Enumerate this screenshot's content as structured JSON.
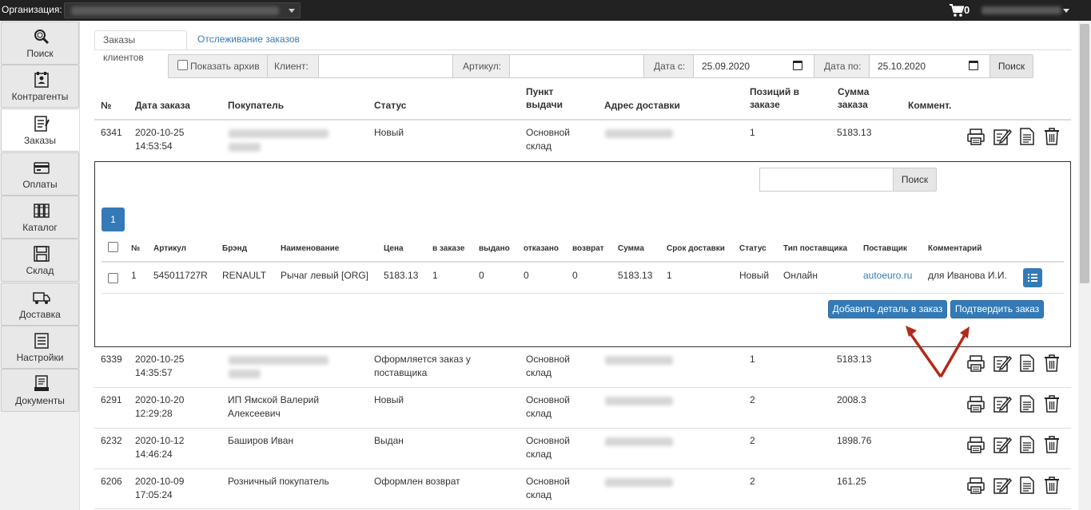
{
  "topbar": {
    "org_label": "Организация:",
    "cart_count": "0",
    "cart_icon": "cart-icon"
  },
  "sidebar": {
    "items": [
      {
        "label": "Поиск",
        "icon": "search-icon"
      },
      {
        "label": "Контрагенты",
        "icon": "contacts-icon"
      },
      {
        "label": "Заказы",
        "icon": "orders-icon"
      },
      {
        "label": "Оплаты",
        "icon": "payments-icon"
      },
      {
        "label": "Каталог",
        "icon": "catalog-icon"
      },
      {
        "label": "Склад",
        "icon": "warehouse-icon"
      },
      {
        "label": "Доставка",
        "icon": "delivery-icon"
      },
      {
        "label": "Настройки",
        "icon": "settings-icon"
      },
      {
        "label": "Документы",
        "icon": "documents-icon"
      }
    ],
    "active": "Заказы"
  },
  "tabs": [
    {
      "label": "Заказы клиентов"
    },
    {
      "label": "Отслеживание заказов"
    }
  ],
  "filter": {
    "archive_label": "Показать архив",
    "client_label": "Клиент:",
    "client_value": "",
    "article_label": "Артикул:",
    "article_value": "",
    "date_from_label": "Дата с:",
    "date_from_value": "25.09.2020",
    "date_to_label": "Дата по:",
    "date_to_value": "25.10.2020",
    "search_button": "Поиск"
  },
  "orders_table": {
    "headers": {
      "num": "№",
      "date": "Дата заказа",
      "buyer": "Покупатель",
      "status": "Статус",
      "pickup_1": "Пункт",
      "pickup_2": "выдачи",
      "address": "Адрес доставки",
      "positions_1": "Позиций в",
      "positions_2": "заказе",
      "sum_1": "Сумма",
      "sum_2": "заказа",
      "comment": "Коммент."
    },
    "rows": [
      {
        "num": "6341",
        "date": "2020-10-25",
        "time": "14:53:54",
        "buyer_1": "",
        "buyer_2": "",
        "status_1": "Новый",
        "status_2": "",
        "pickup_1": "Основной",
        "pickup_2": "склад",
        "positions": "1",
        "sum": "5183.13"
      },
      {
        "num": "6339",
        "date": "2020-10-25",
        "time": "14:35:57",
        "buyer_1": "",
        "buyer_2": "",
        "status_1": "Оформляется заказ у",
        "status_2": "поставщика",
        "pickup_1": "Основной",
        "pickup_2": "склад",
        "positions": "1",
        "sum": "5183.13"
      },
      {
        "num": "6291",
        "date": "2020-10-20",
        "time": "12:29:28",
        "buyer_1": "ИП Ямской Валерий",
        "buyer_2": "Алексеевич",
        "status_1": "Новый",
        "status_2": "",
        "pickup_1": "Основной",
        "pickup_2": "склад",
        "positions": "2",
        "sum": "2008.3"
      },
      {
        "num": "6232",
        "date": "2020-10-12",
        "time": "14:46:24",
        "buyer_1": "Баширов Иван",
        "buyer_2": "",
        "status_1": "Выдан",
        "status_2": "",
        "pickup_1": "Основной",
        "pickup_2": "склад",
        "positions": "2",
        "sum": "1898.76"
      },
      {
        "num": "6206",
        "date": "2020-10-09",
        "time": "17:05:24",
        "buyer_1": "Розничный покупатель",
        "buyer_2": "",
        "status_1": "Оформлен возврат",
        "status_2": "",
        "pickup_1": "Основной",
        "pickup_2": "склад",
        "positions": "2",
        "sum": "161.25"
      }
    ],
    "row_actions": [
      "print-icon",
      "edit-icon",
      "document-icon",
      "trash-icon"
    ]
  },
  "detail_panel": {
    "search_button": "Поиск",
    "search_value": "",
    "page": "1",
    "headers": {
      "num": "№",
      "article": "Артикул",
      "brand": "Брэнд",
      "name": "Наименование",
      "price": "Цена",
      "in_order": "в заказе",
      "issued": "выдано",
      "refused": "отказано",
      "returned": "возврат",
      "sum": "Сумма",
      "delivery": "Срок доставки",
      "status": "Статус",
      "supplier_type": "Тип поставщика",
      "supplier": "Поставщик",
      "comment": "Комментарий"
    },
    "items": [
      {
        "num": "1",
        "article": "545011727R",
        "brand": "RENAULT",
        "name": "Рычаг левый [ORG]",
        "price": "5183.13",
        "in_order": "1",
        "issued": "0",
        "refused": "0",
        "returned": "0",
        "sum": "5183.13",
        "delivery": "1",
        "status": "Новый",
        "supplier_type": "Онлайн",
        "supplier": "autoeuro.ru",
        "comment": "для Иванова И.И."
      }
    ],
    "add_button": "Добавить деталь в заказ",
    "confirm_button": "Подтвердить заказ"
  },
  "colors": {
    "accent": "#337ab7",
    "topbar": "#222222",
    "annotation_arrow": "#b22a1a"
  }
}
